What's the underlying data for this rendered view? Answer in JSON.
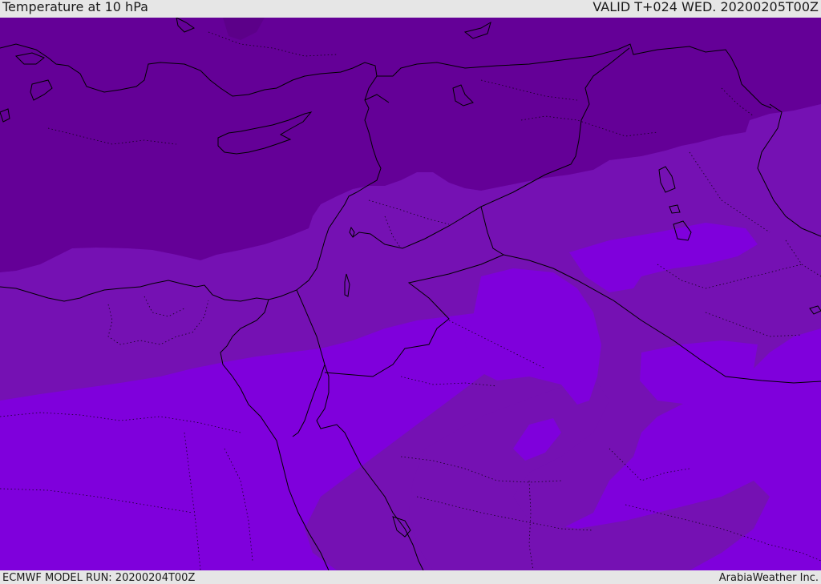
{
  "header": {
    "title": "Temperature at 10 hPa",
    "valid_time": "VALID T+024 WED. 20200205T00Z"
  },
  "footer": {
    "model_run": "ECMWF MODEL RUN: 20200204T00Z",
    "credit": "ArabiaWeather Inc."
  },
  "map": {
    "variable": "Temperature",
    "pressure_level": "10 hPa",
    "colors": {
      "cold_band": "#640097",
      "middle_band": "#7511b3",
      "warm_band": "#7f00dc",
      "coastline": "#000000",
      "border": "#000000"
    },
    "layers": [
      "coastlines",
      "country-borders",
      "internal-boundaries"
    ]
  }
}
